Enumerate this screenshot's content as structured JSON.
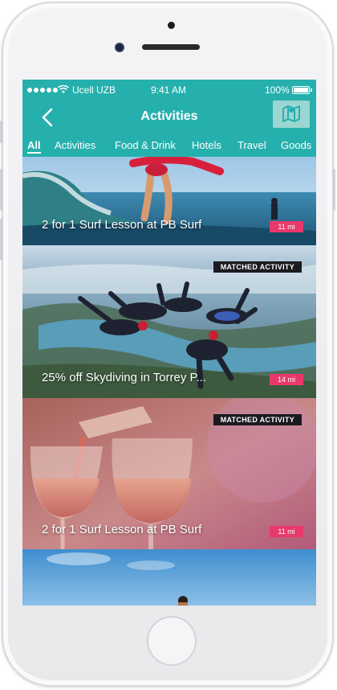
{
  "status": {
    "carrier": "Ucell UZB",
    "time": "9:41 AM",
    "battery": "100%"
  },
  "nav": {
    "title": "Activities",
    "back_icon": "chevron-left-icon",
    "map_icon": "map-icon"
  },
  "tabs": [
    "All",
    "Activities",
    "Food & Drink",
    "Hotels",
    "Travel",
    "Goods"
  ],
  "active_tab": "All",
  "cards": [
    {
      "title": "2 for 1 Surf Lesson at PB Surf",
      "distance": "11 mi",
      "badge": ""
    },
    {
      "title": "25% off  Skydiving in Torrey P...",
      "distance": "14 mi",
      "badge": "MATCHED ACTIVITY"
    },
    {
      "title": "2 for 1 Surf Lesson at PB Surf",
      "distance": "11 mi",
      "badge": "MATCHED ACTIVITY"
    }
  ],
  "colors": {
    "brand_teal": "#26b0ad",
    "distance_pink": "#e8396a",
    "badge_dark": "#1b1b1f"
  }
}
